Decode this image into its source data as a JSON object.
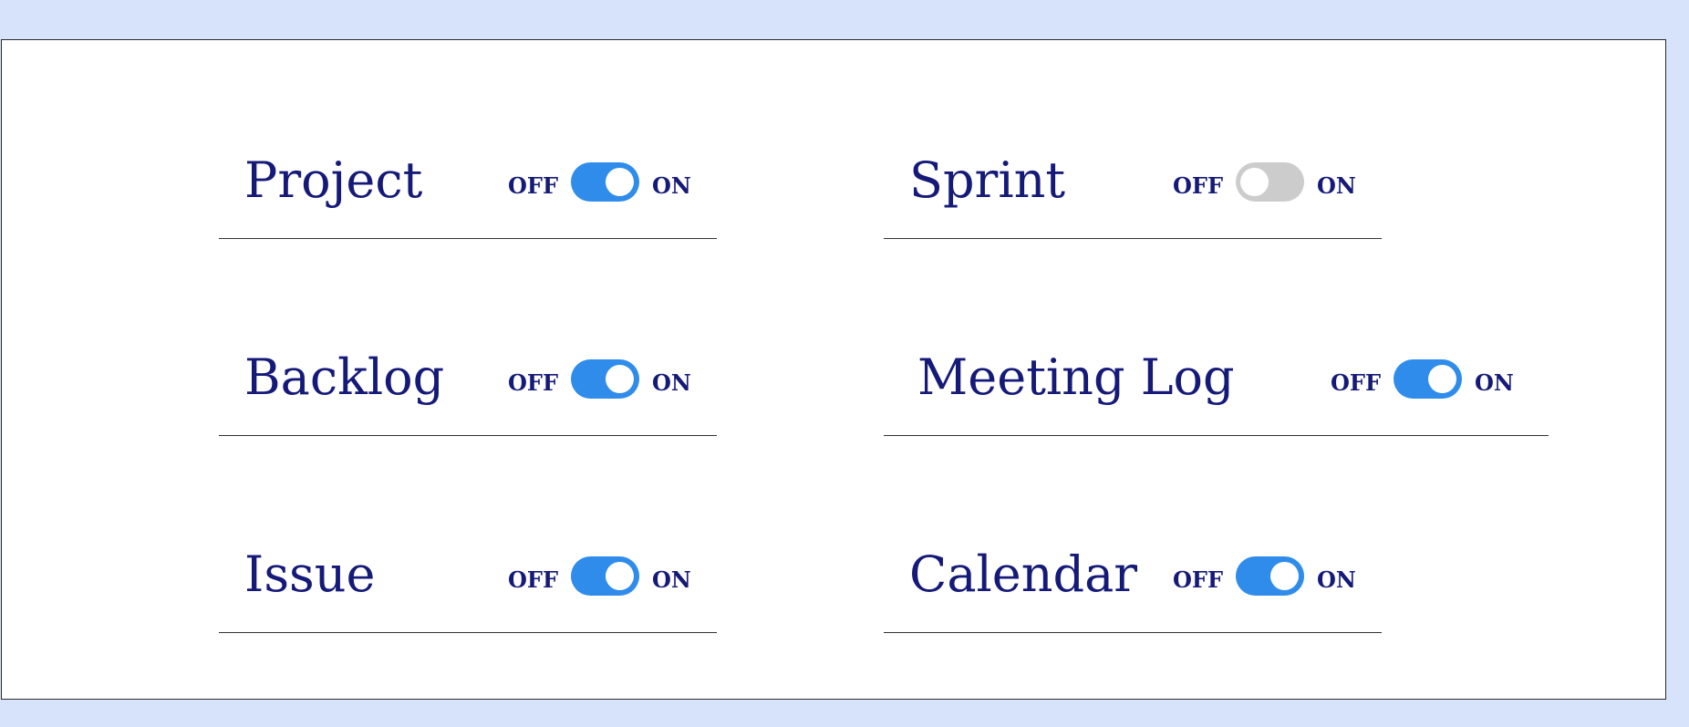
{
  "colors": {
    "page_background": "#d6e3fb",
    "panel_background": "#ffffff",
    "label_text": "#151a78",
    "toggle_on": "#2f8cea",
    "toggle_off": "#cccccc"
  },
  "settings": [
    {
      "label": "Project",
      "off_label": "OFF",
      "on_label": "ON",
      "enabled": true
    },
    {
      "label": "Sprint",
      "off_label": "OFF",
      "on_label": "ON",
      "enabled": false
    },
    {
      "label": "Backlog",
      "off_label": "OFF",
      "on_label": "ON",
      "enabled": true
    },
    {
      "label": "Meeting Log",
      "off_label": "OFF",
      "on_label": "ON",
      "enabled": true
    },
    {
      "label": "Issue",
      "off_label": "OFF",
      "on_label": "ON",
      "enabled": true
    },
    {
      "label": "Calendar",
      "off_label": "OFF",
      "on_label": "ON",
      "enabled": true
    }
  ]
}
